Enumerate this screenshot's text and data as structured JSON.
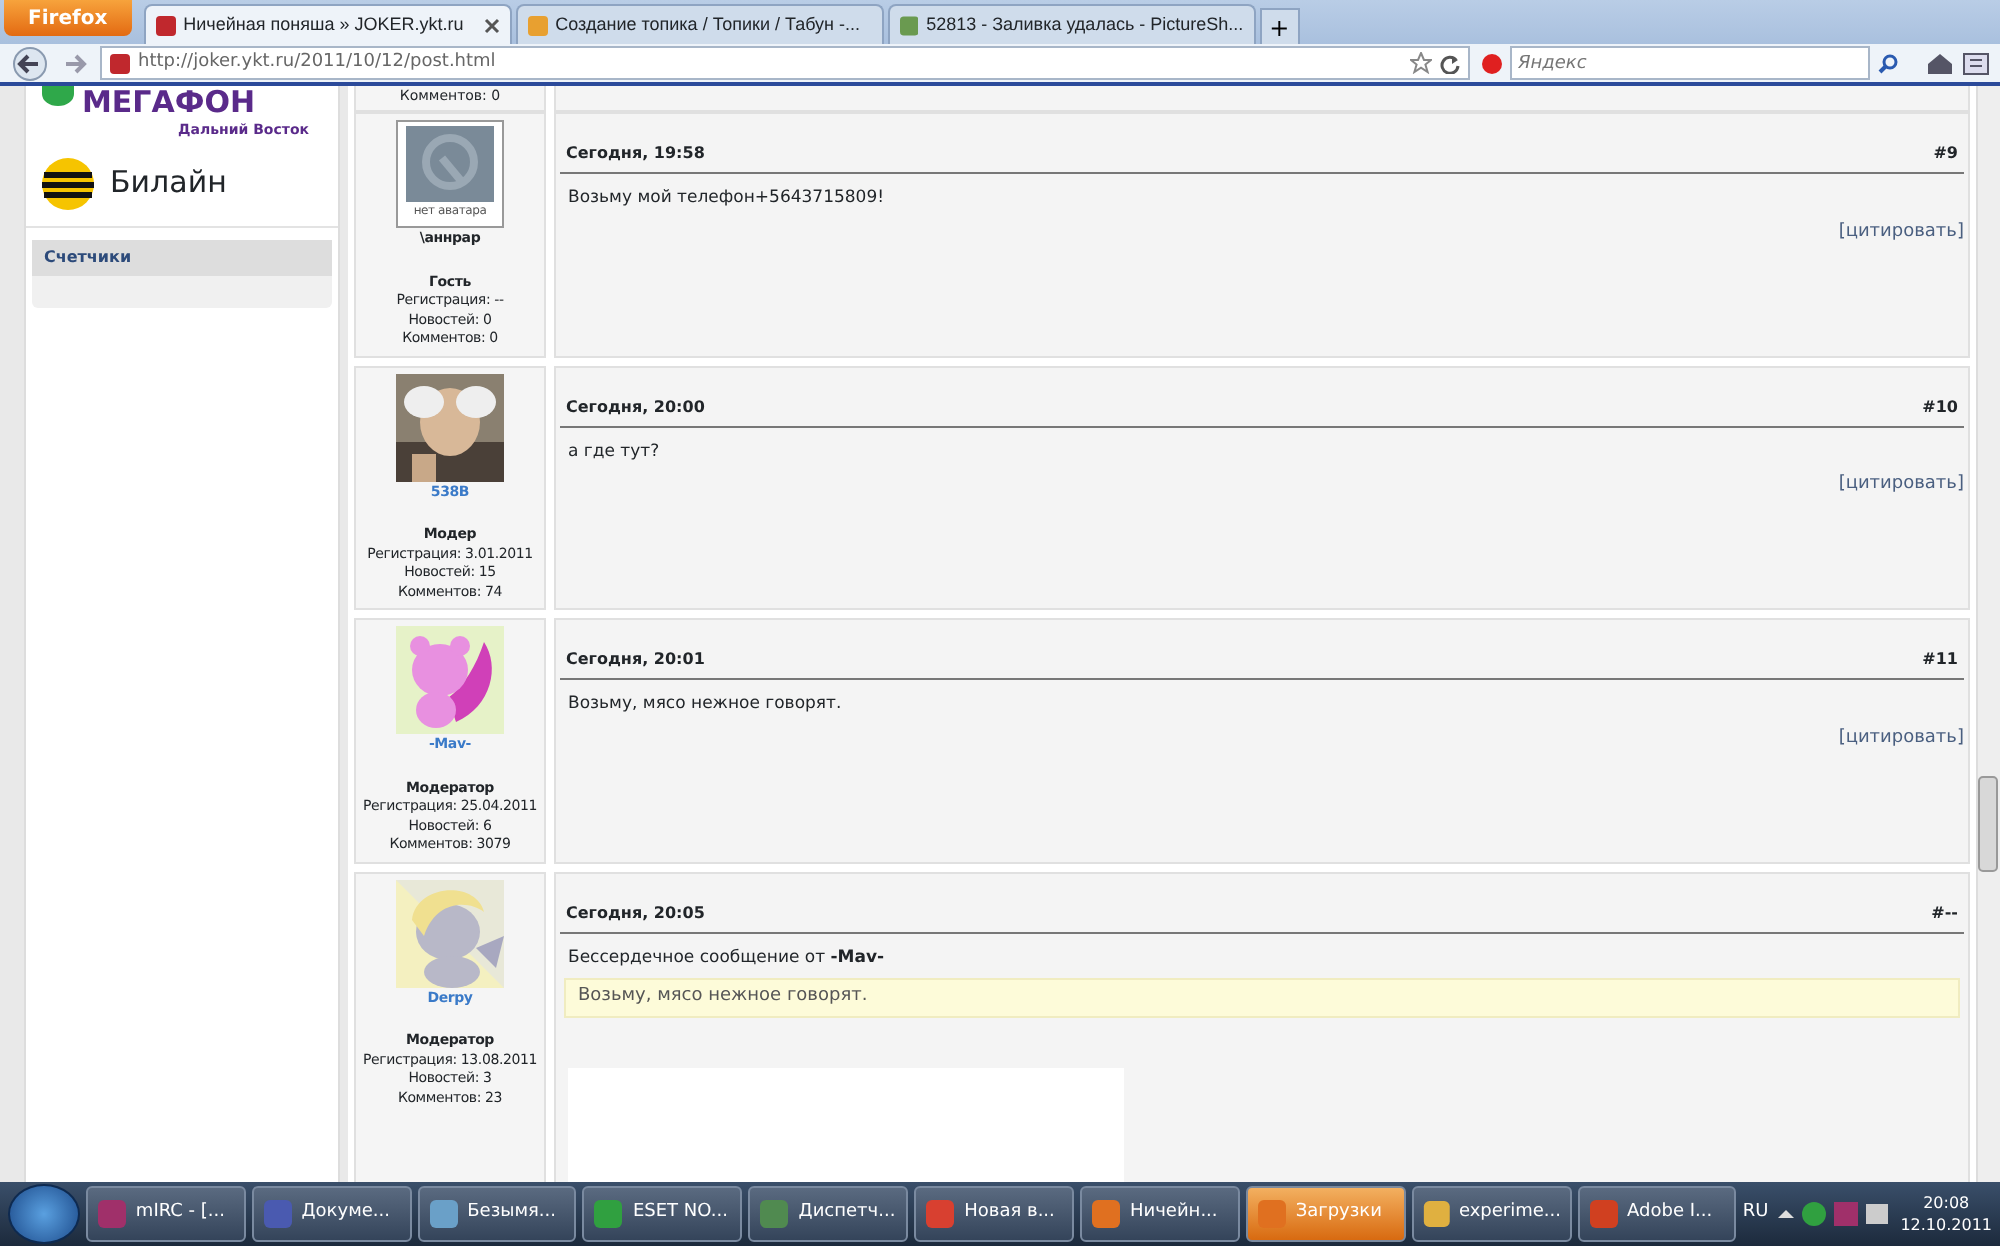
{
  "browser": {
    "menu_button": "Firefox",
    "tabs": [
      {
        "title": "Ничейная поняша » JOKER.ykt.ru",
        "selected": true,
        "color": "#c0282d"
      },
      {
        "title": "Создание топика / Топики / Табун -...",
        "selected": false,
        "color": "#e8a030"
      },
      {
        "title": "52813 - Заливка удалась - PictureSh...",
        "selected": false,
        "color": "#6a9a50"
      }
    ],
    "new_tab": "+",
    "url": "http://joker.ykt.ru/2011/10/12/post.html",
    "search": {
      "placeholder": "Яндекс"
    }
  },
  "sidebar": {
    "logos": [
      {
        "name": "МЕГАФОН",
        "subtitle": "Дальний Восток",
        "kind": "megafon"
      },
      {
        "name": "Билайн",
        "kind": "beeline"
      }
    ],
    "blocks": [
      {
        "title": "Счетчики"
      }
    ]
  },
  "previous_post_tail": "Комментов: 0",
  "posts": [
    {
      "author": "\\аннрар",
      "linked": false,
      "avatar": {
        "kind": "none",
        "label": "нет аватара"
      },
      "role": "Гость",
      "stats": [
        "Регистрация: --",
        "Новостей: 0",
        "Комментов: 0"
      ],
      "date": "Сегодня, 19:58",
      "number": "#9",
      "text": "Возьму мой телефон+5643715809!",
      "quote_link": "[цитировать]"
    },
    {
      "author": "538B",
      "linked": true,
      "avatar": {
        "kind": "person"
      },
      "role": "Модер",
      "stats": [
        "Регистрация: 3.01.2011",
        "Новостей: 15",
        "Комментов: 74"
      ],
      "date": "Сегодня, 20:00",
      "number": "#10",
      "text": "а где тут?",
      "quote_link": "[цитировать]"
    },
    {
      "author": "-Mav-",
      "linked": true,
      "avatar": {
        "kind": "creature"
      },
      "role": "Модератор",
      "stats": [
        "Регистрация: 25.04.2011",
        "Новостей: 6",
        "Комментов: 3079"
      ],
      "date": "Сегодня, 20:01",
      "number": "#11",
      "text": "Возьму, мясо нежное говорят.",
      "quote_link": "[цитировать]"
    },
    {
      "author": "Derpy",
      "linked": true,
      "avatar": {
        "kind": "pony"
      },
      "role": "Модератор",
      "stats": [
        "Регистрация: 13.08.2011",
        "Новостей: 3",
        "Комментов: 23"
      ],
      "date": "Сегодня, 20:05",
      "number": "#--",
      "text": "Бессердечное сообщение от **-Mav-**",
      "quote": "Возьму, мясо нежное говорят.",
      "blank_image": true
    }
  ],
  "taskbar": {
    "items": [
      {
        "label": "mIRC - [...",
        "selected": false,
        "color": "#a0306a"
      },
      {
        "label": "Докуме...",
        "selected": false,
        "color": "#4a5ab0"
      },
      {
        "label": "Безымя...",
        "selected": false,
        "color": "#6aa0c8"
      },
      {
        "label": "ESET NO...",
        "selected": false,
        "color": "#30a040"
      },
      {
        "label": "Диспетч...",
        "selected": false,
        "color": "#508a50"
      },
      {
        "label": "Новая в...",
        "selected": false,
        "color": "#d84030"
      },
      {
        "label": "Ничейн...",
        "selected": false,
        "color": "#e07020"
      },
      {
        "label": "Загрузки",
        "selected": true,
        "color": "#e07020"
      },
      {
        "label": "experime...",
        "selected": false,
        "color": "#e0b040"
      },
      {
        "label": "Adobe I...",
        "selected": false,
        "color": "#d04020"
      }
    ],
    "language": "RU",
    "time": "20:08",
    "date": "12.10.2011"
  }
}
